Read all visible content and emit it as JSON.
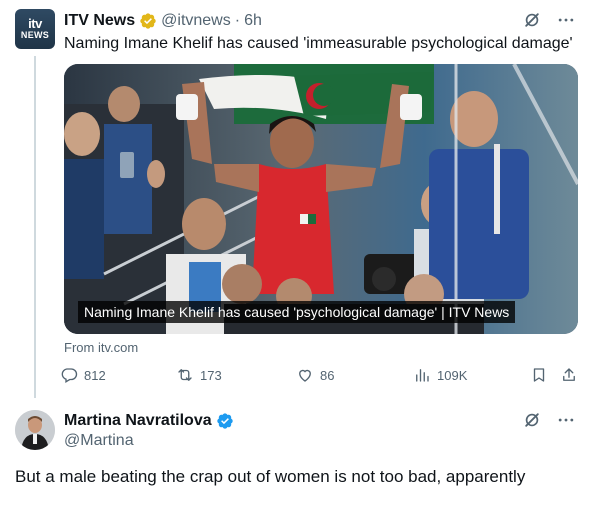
{
  "tweet": {
    "author": {
      "display_name": "ITV News",
      "handle": "@itvnews",
      "separator": "·",
      "time": "6h",
      "avatar_text_top": "itv",
      "avatar_text_bottom": "NEWS",
      "verified": "gold"
    },
    "text": "Naming Imane Khelif has caused 'immeasurable psychological damage'",
    "media": {
      "caption": "Naming Imane Khelif has caused 'psychological damage' | ITV News"
    },
    "link_source": "From itv.com",
    "stats": {
      "replies": "812",
      "retweets": "173",
      "likes": "86",
      "views": "109K"
    },
    "icons": {
      "grok": "grok-icon",
      "more": "more-icon",
      "reply": "reply-icon",
      "retweet": "retweet-icon",
      "like": "heart-icon",
      "views": "views-icon",
      "bookmark": "bookmark-icon",
      "share": "share-icon"
    }
  },
  "reply": {
    "author": {
      "display_name": "Martina Navratilova",
      "handle": "@Martina",
      "verified": "blue"
    },
    "text": "But a male beating the crap out of women is not too bad, apparently"
  },
  "colors": {
    "text_primary": "#0f1419",
    "text_secondary": "#536471",
    "verified_gold": "#e2b719",
    "verified_blue": "#1d9bf0",
    "thread_line": "#cfd9de"
  }
}
